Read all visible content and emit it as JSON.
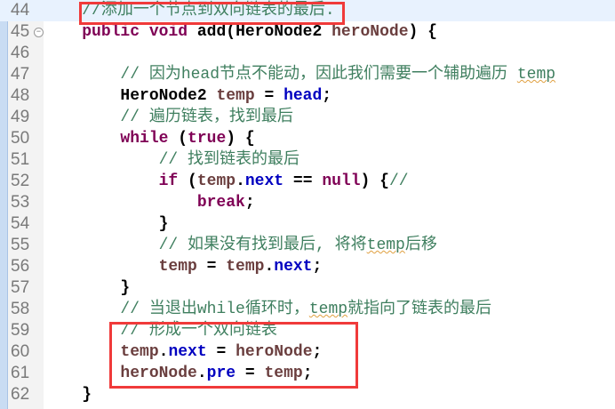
{
  "editor": {
    "current_line": 44,
    "colors": {
      "keyword": "#7f0055",
      "comment": "#3f7f5f",
      "field": "#0000c0",
      "local": "#6a3e3e",
      "highlight_box": "#f03a3a"
    },
    "lines": [
      {
        "n": "44",
        "tokens": [
          {
            "t": "    "
          },
          {
            "t": "//添加一个节点到双向链表的最后.",
            "c": "cm"
          }
        ]
      },
      {
        "n": "45",
        "fold": true,
        "tokens": [
          {
            "t": "    "
          },
          {
            "t": "public",
            "c": "kw"
          },
          {
            "t": " "
          },
          {
            "t": "void",
            "c": "kw"
          },
          {
            "t": " add(HeroNode2 "
          },
          {
            "t": "heroNode",
            "c": "lv"
          },
          {
            "t": ") {"
          }
        ]
      },
      {
        "n": "46",
        "tokens": []
      },
      {
        "n": "47",
        "tokens": [
          {
            "t": "        "
          },
          {
            "t": "// 因为head节点不能动，因此我们需要一个辅助遍历 ",
            "c": "cm"
          },
          {
            "t": "temp",
            "c": "cm sq"
          }
        ]
      },
      {
        "n": "48",
        "tokens": [
          {
            "t": "        HeroNode2 "
          },
          {
            "t": "temp",
            "c": "lv"
          },
          {
            "t": " = "
          },
          {
            "t": "head",
            "c": "fd"
          },
          {
            "t": ";"
          }
        ]
      },
      {
        "n": "49",
        "tokens": [
          {
            "t": "        "
          },
          {
            "t": "// 遍历链表，找到最后",
            "c": "cm"
          }
        ]
      },
      {
        "n": "50",
        "tokens": [
          {
            "t": "        "
          },
          {
            "t": "while",
            "c": "kw"
          },
          {
            "t": " ("
          },
          {
            "t": "true",
            "c": "kw"
          },
          {
            "t": ") {"
          }
        ]
      },
      {
        "n": "51",
        "tokens": [
          {
            "t": "            "
          },
          {
            "t": "// 找到链表的最后",
            "c": "cm"
          }
        ]
      },
      {
        "n": "52",
        "tokens": [
          {
            "t": "            "
          },
          {
            "t": "if",
            "c": "kw"
          },
          {
            "t": " ("
          },
          {
            "t": "temp",
            "c": "lv"
          },
          {
            "t": "."
          },
          {
            "t": "next",
            "c": "fd"
          },
          {
            "t": " == "
          },
          {
            "t": "null",
            "c": "kw"
          },
          {
            "t": ") {"
          },
          {
            "t": "//",
            "c": "cm"
          }
        ]
      },
      {
        "n": "53",
        "tokens": [
          {
            "t": "                "
          },
          {
            "t": "break",
            "c": "kw"
          },
          {
            "t": ";"
          }
        ]
      },
      {
        "n": "54",
        "tokens": [
          {
            "t": "            }"
          }
        ]
      },
      {
        "n": "55",
        "tokens": [
          {
            "t": "            "
          },
          {
            "t": "// 如果没有找到最后, 将将",
            "c": "cm"
          },
          {
            "t": "temp",
            "c": "cm sq"
          },
          {
            "t": "后移",
            "c": "cm"
          }
        ]
      },
      {
        "n": "56",
        "tokens": [
          {
            "t": "            "
          },
          {
            "t": "temp",
            "c": "lv"
          },
          {
            "t": " = "
          },
          {
            "t": "temp",
            "c": "lv"
          },
          {
            "t": "."
          },
          {
            "t": "next",
            "c": "fd"
          },
          {
            "t": ";"
          }
        ]
      },
      {
        "n": "57",
        "tokens": [
          {
            "t": "        }"
          }
        ]
      },
      {
        "n": "58",
        "tokens": [
          {
            "t": "        "
          },
          {
            "t": "// 当退出while循环时，",
            "c": "cm"
          },
          {
            "t": "temp",
            "c": "cm sq"
          },
          {
            "t": "就指向了链表的最后",
            "c": "cm"
          }
        ]
      },
      {
        "n": "59",
        "tokens": [
          {
            "t": "        "
          },
          {
            "t": "// 形成一个双向链表",
            "c": "cm"
          }
        ]
      },
      {
        "n": "60",
        "tokens": [
          {
            "t": "        "
          },
          {
            "t": "temp",
            "c": "lv"
          },
          {
            "t": "."
          },
          {
            "t": "next",
            "c": "fd"
          },
          {
            "t": " = "
          },
          {
            "t": "heroNode",
            "c": "lv"
          },
          {
            "t": ";"
          }
        ]
      },
      {
        "n": "61",
        "tokens": [
          {
            "t": "        "
          },
          {
            "t": "heroNode",
            "c": "lv"
          },
          {
            "t": "."
          },
          {
            "t": "pre",
            "c": "fd"
          },
          {
            "t": " = "
          },
          {
            "t": "temp",
            "c": "lv"
          },
          {
            "t": ";"
          }
        ]
      },
      {
        "n": "62",
        "tokens": [
          {
            "t": "    }"
          }
        ]
      }
    ]
  }
}
